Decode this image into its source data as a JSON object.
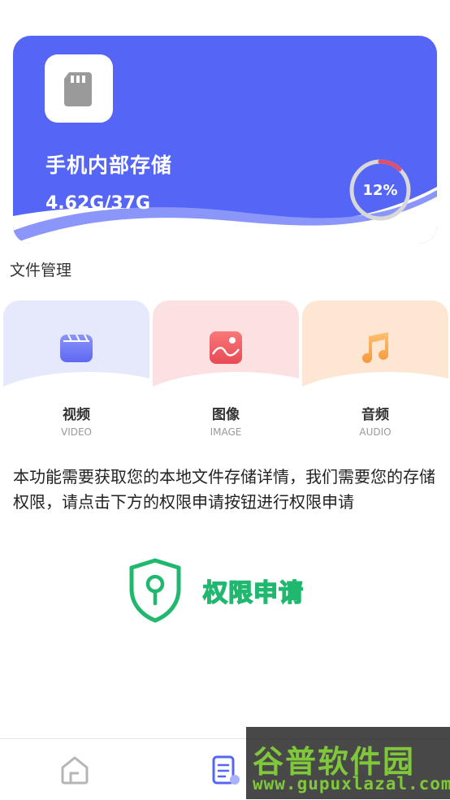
{
  "storage": {
    "title": "手机内部存储",
    "size_text": "4.62G/37G",
    "percent_text": "12%",
    "percent_used": 0.12
  },
  "section": {
    "title": "文件管理"
  },
  "categories": [
    {
      "label": "视频",
      "sub": "VIDEO",
      "icon": "video-icon"
    },
    {
      "label": "图像",
      "sub": "IMAGE",
      "icon": "image-icon"
    },
    {
      "label": "音频",
      "sub": "AUDIO",
      "icon": "audio-icon"
    }
  ],
  "notice": {
    "text": "本功能需要获取您的本地文件存储详情，我们需要您的存储权限，请点击下方的权限申请按钮进行权限申请"
  },
  "permission": {
    "label": "权限申请",
    "icon": "shield-key-icon"
  },
  "tabs": [
    {
      "icon": "home-icon"
    },
    {
      "icon": "document-icon"
    }
  ],
  "watermark": {
    "line1": "谷普软件园",
    "line2": "www.gupuxlazal.com"
  },
  "colors": {
    "card": "#5566f6",
    "video_bg": "#e6e8fb",
    "image_bg": "#fbe1e1",
    "audio_bg": "#fde7d3",
    "perm_green": "#1fb86e"
  }
}
